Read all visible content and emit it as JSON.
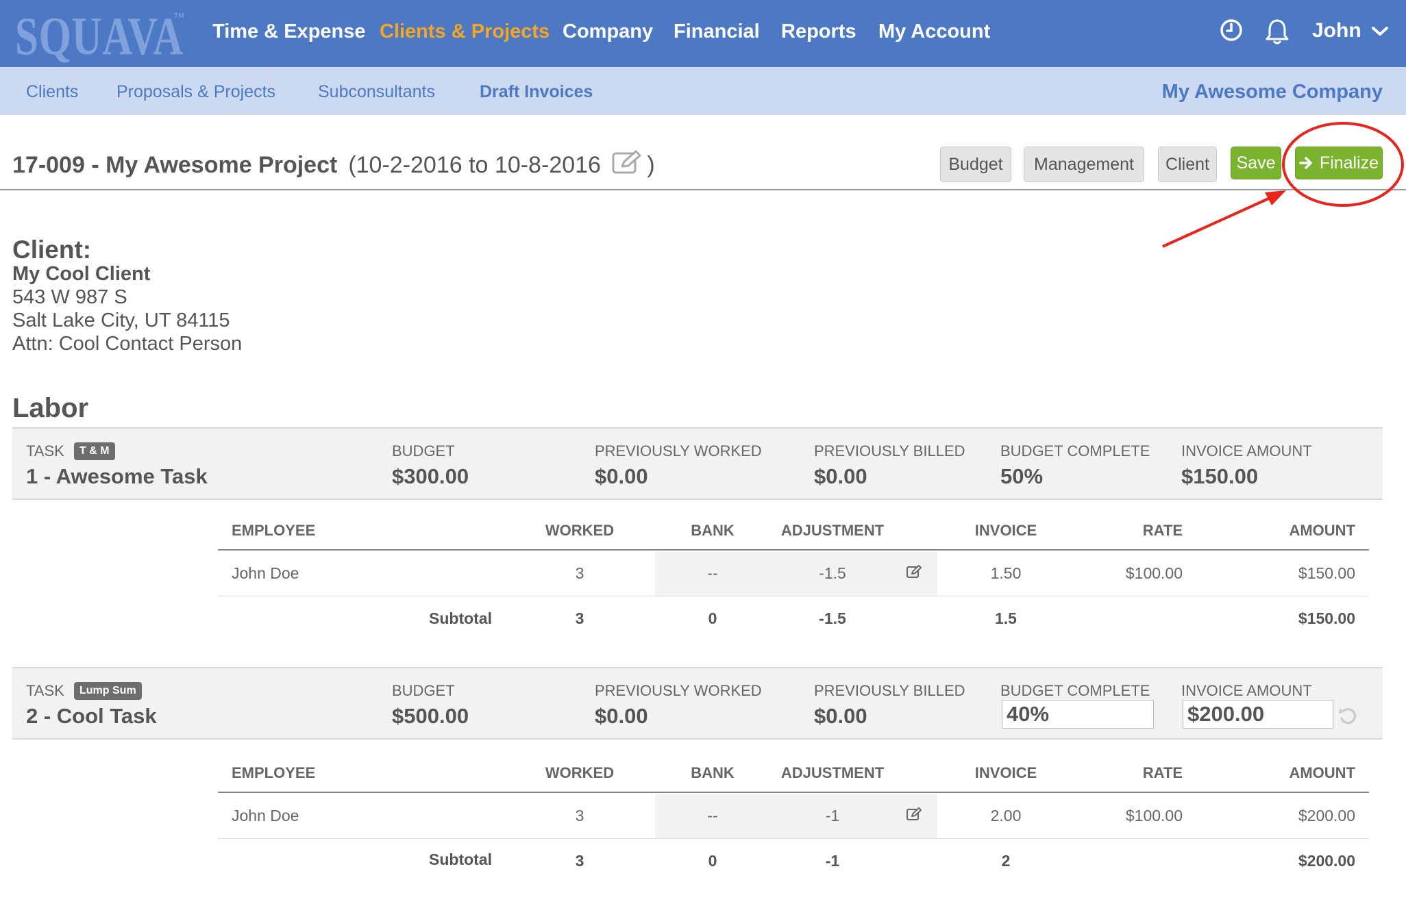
{
  "nav": {
    "logo": "SQUAVA",
    "logo_tm": "TM",
    "items": [
      "Time & Expense",
      "Clients & Projects",
      "Company",
      "Financial",
      "Reports",
      "My Account"
    ],
    "active_index": 1,
    "user": "John"
  },
  "subnav": {
    "items": [
      "Clients",
      "Proposals & Projects",
      "Subconsultants",
      "Draft Invoices"
    ],
    "active_index": 3,
    "company": "My Awesome Company"
  },
  "header": {
    "project": "17-009 - My Awesome Project",
    "dates_open": "(10-2-2016 to 10-8-2016",
    "dates_close": ")",
    "buttons": {
      "budget": "Budget",
      "management": "Management",
      "client": "Client",
      "save": "Save",
      "finalize": "Finalize"
    }
  },
  "client": {
    "heading": "Client:",
    "name": "My Cool Client",
    "address1": "543 W 987 S",
    "address2": "Salt Lake City, UT 84115",
    "attn": "Attn: Cool Contact Person"
  },
  "labor": {
    "heading": "Labor",
    "stat_labels": {
      "task": "TASK",
      "budget": "BUDGET",
      "previously_worked": "PREVIOUSLY WORKED",
      "previously_billed": "PREVIOUSLY BILLED",
      "budget_complete": "BUDGET COMPLETE",
      "invoice_amount": "INVOICE AMOUNT"
    },
    "columns": {
      "employee": "EMPLOYEE",
      "worked": "WORKED",
      "bank": "BANK",
      "adjustment": "ADJUSTMENT",
      "invoice": "INVOICE",
      "rate": "RATE",
      "amount": "AMOUNT"
    },
    "tasks": [
      {
        "badge": "T & M",
        "name": "1 - Awesome Task",
        "budget": "$300.00",
        "previously_worked": "$0.00",
        "previously_billed": "$0.00",
        "budget_complete": "50%",
        "invoice_amount": "$150.00",
        "rows": [
          {
            "employee": "John Doe",
            "worked": "3",
            "bank": "--",
            "adjustment": "-1.5",
            "invoice": "1.50",
            "rate": "$100.00",
            "amount": "$150.00"
          }
        ],
        "subtotal": {
          "label": "Subtotal",
          "worked": "3",
          "bank": "0",
          "adjustment": "-1.5",
          "invoice": "1.5",
          "amount": "$150.00"
        }
      },
      {
        "badge": "Lump Sum",
        "name": "2 - Cool Task",
        "budget": "$500.00",
        "previously_worked": "$0.00",
        "previously_billed": "$0.00",
        "budget_complete": "40%",
        "invoice_amount": "$200.00",
        "rows": [
          {
            "employee": "John Doe",
            "worked": "3",
            "bank": "--",
            "adjustment": "-1",
            "invoice": "2.00",
            "rate": "$100.00",
            "amount": "$200.00"
          }
        ],
        "subtotal": {
          "label": "Subtotal",
          "worked": "3",
          "bank": "0",
          "adjustment": "-1",
          "invoice": "2",
          "amount": "$200.00"
        }
      }
    ]
  },
  "colors": {
    "nav_bg": "#4d78c3",
    "subnav_bg": "#cbdaf0",
    "active_nav": "#f5a623",
    "green_button": "#7ab32e",
    "annotation": "#e8241d"
  }
}
